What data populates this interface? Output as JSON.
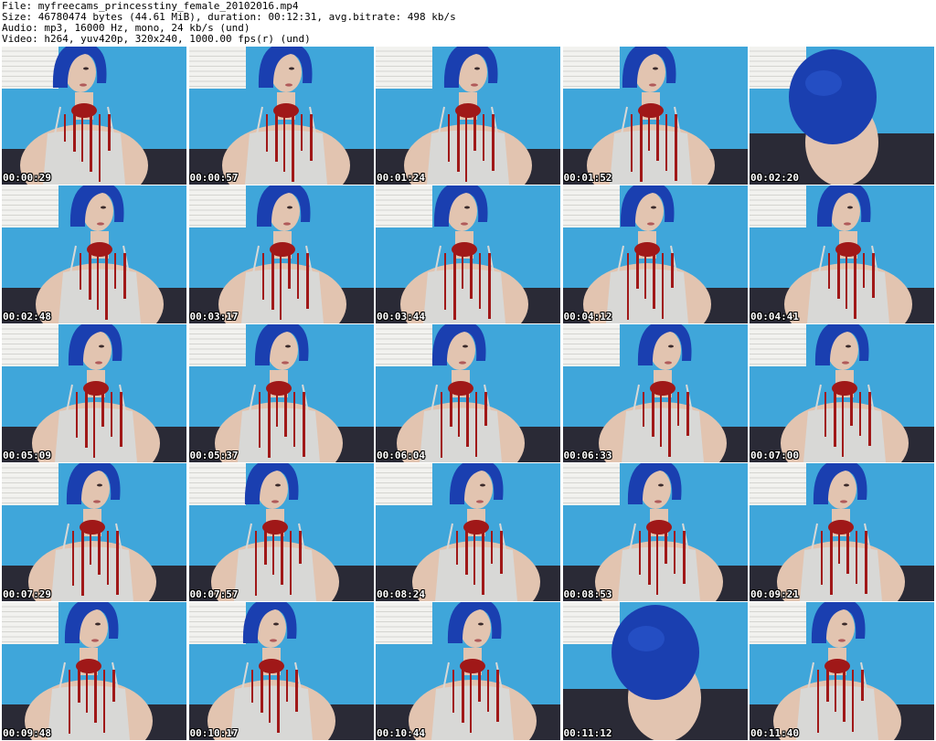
{
  "header": {
    "file": "File: myfreecams_princesstiny_female_20102016.mp4",
    "size": "Size: 46780474 bytes (44.61 MiB), duration: 00:12:31, avg.bitrate: 498 kb/s",
    "audio": "Audio: mp3, 16000 Hz, mono, 24 kb/s (und)",
    "video": "Video: h264, yuv420p, 320x240, 1000.00 fps(r) (und)"
  },
  "thumbnails": [
    {
      "timestamp": "00:00:29"
    },
    {
      "timestamp": "00:00:57"
    },
    {
      "timestamp": "00:01:24"
    },
    {
      "timestamp": "00:01:52"
    },
    {
      "timestamp": "00:02:20"
    },
    {
      "timestamp": "00:02:48"
    },
    {
      "timestamp": "00:03:17"
    },
    {
      "timestamp": "00:03:44"
    },
    {
      "timestamp": "00:04:12"
    },
    {
      "timestamp": "00:04:41"
    },
    {
      "timestamp": "00:05:09"
    },
    {
      "timestamp": "00:05:37"
    },
    {
      "timestamp": "00:06:04"
    },
    {
      "timestamp": "00:06:33"
    },
    {
      "timestamp": "00:07:00"
    },
    {
      "timestamp": "00:07:29"
    },
    {
      "timestamp": "00:07:57"
    },
    {
      "timestamp": "00:08:24"
    },
    {
      "timestamp": "00:08:53"
    },
    {
      "timestamp": "00:09:21"
    },
    {
      "timestamp": "00:09:48"
    },
    {
      "timestamp": "00:10:17"
    },
    {
      "timestamp": "00:10:44"
    },
    {
      "timestamp": "00:11:12"
    },
    {
      "timestamp": "00:11:40"
    }
  ],
  "colors": {
    "background": "#ffffff",
    "header_text": "#000000",
    "wall": "#3fa6da",
    "hair": "#1a3fb0",
    "skin": "#e2c4b0",
    "top": "#d8d8d6",
    "stain": "#a01818",
    "blinds": "#f2f2ef",
    "dark_floor": "#2a2a36"
  }
}
